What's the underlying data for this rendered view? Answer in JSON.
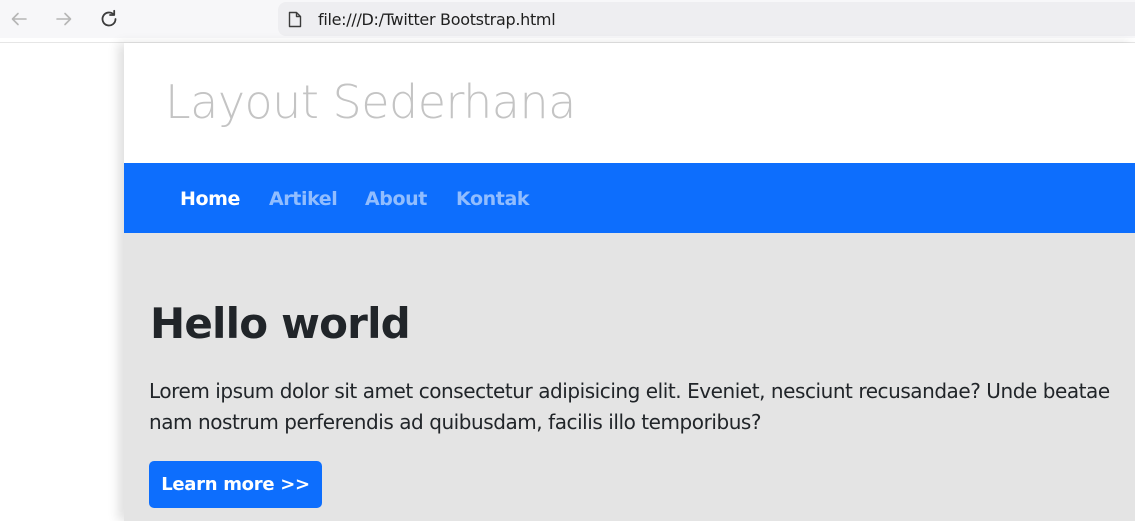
{
  "browser": {
    "url": "file:///D:/Twitter Bootstrap.html",
    "icons": {
      "back": "arrow-left-icon",
      "forward": "arrow-right-icon",
      "reload": "reload-icon",
      "page": "file-icon"
    }
  },
  "page": {
    "site_title": "Layout Sederhana",
    "nav": {
      "items": [
        {
          "label": "Home",
          "active": true
        },
        {
          "label": "Artikel",
          "active": false
        },
        {
          "label": "About",
          "active": false
        },
        {
          "label": "Kontak",
          "active": false
        }
      ]
    },
    "hero": {
      "title": "Hello world",
      "text": "Lorem ipsum dolor sit amet consectetur adipisicing elit. Eveniet, nesciunt recusandae? Unde beatae\nnam nostrum perferendis ad quibusdam, facilis illo temporibus?",
      "button_label": "Learn more >>"
    }
  },
  "colors": {
    "primary": "#0d6efd",
    "jumbotron_bg": "#e4e4e4",
    "site_title": "#c4c4c4",
    "text": "#212529"
  }
}
